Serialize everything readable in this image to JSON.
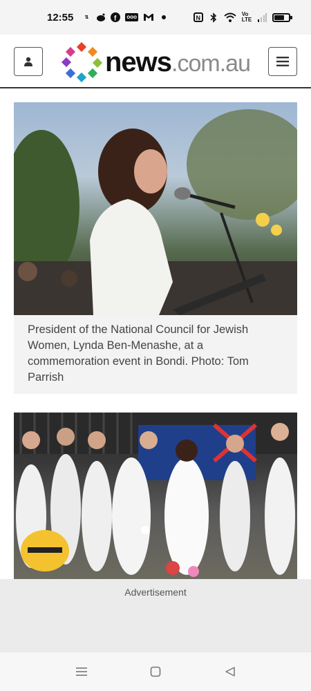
{
  "status_bar": {
    "time": "12:55",
    "left_icons": [
      "data-icon",
      "reddit-icon",
      "facebook-icon",
      "news-box-icon",
      "gmail-icon",
      "dot-icon"
    ],
    "right_icons": [
      "nfc-icon",
      "bluetooth-icon",
      "wifi-icon",
      "volte-icon",
      "signal-icon",
      "battery-icon"
    ],
    "battery_level": 0.8
  },
  "header": {
    "logo_primary": "news",
    "logo_secondary": ".com.au",
    "account_button_icon": "person-icon",
    "menu_button_icon": "hamburger-menu-icon"
  },
  "article": {
    "figures": [
      {
        "image_alt": "Lynda Ben-Menashe speaking at a microphone",
        "caption": "President of the National Council for Jewish Women, Lynda Ben-Menashe, at a commemoration event in Bondi. Photo: Tom Parrish"
      },
      {
        "image_alt": "Women dressed in white at a memorial with flowers and an Australian flag",
        "caption": ""
      }
    ]
  },
  "advertisement": {
    "label": "Advertisement"
  },
  "nav_bar": {
    "icons": [
      "recent-apps-icon",
      "home-icon",
      "back-icon"
    ]
  },
  "colors": {
    "header_border": "#333333",
    "caption_bg": "#f3f3f3",
    "ad_bg": "#ebebeb",
    "logo_text": "#111111",
    "logo_domain": "#8a8a8a"
  }
}
